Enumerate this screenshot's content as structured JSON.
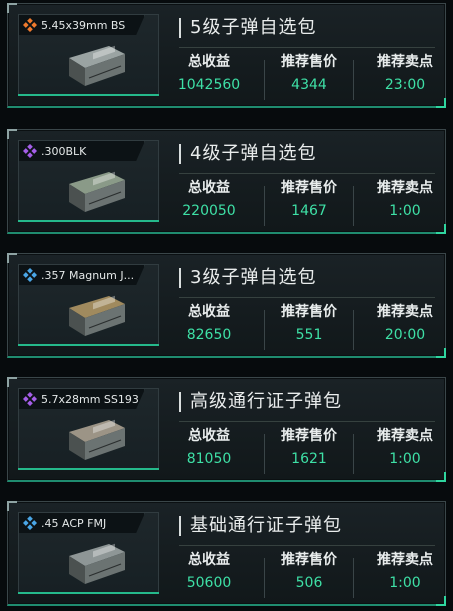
{
  "labels": {
    "total": "总收益",
    "price": "推荐售价",
    "time": "推荐卖点"
  },
  "colors": {
    "value_green": "#3ee0a6",
    "accent_green": "#25b98b"
  },
  "packs": [
    {
      "caliber": "5.45x39mm BS",
      "title": "5级子弹自选包",
      "total": "1042560",
      "price": "4344",
      "time": "23:00",
      "icon": "orange-diamond-icon",
      "icon_color": "#f07a2d",
      "ammo_color": "#9aa3a2"
    },
    {
      "caliber": ".300BLK",
      "title": "4级子弹自选包",
      "total": "220050",
      "price": "1467",
      "time": "1:00",
      "icon": "purple-diamond-icon",
      "icon_color": "#a45ee8",
      "ammo_color": "#8a9a88"
    },
    {
      "caliber": ".357 Magnum J...",
      "title": "3级子弹自选包",
      "total": "82650",
      "price": "551",
      "time": "20:00",
      "icon": "blue-diamond-icon",
      "icon_color": "#4aa6e6",
      "ammo_color": "#a08a5e"
    },
    {
      "caliber": "5.7x28mm SS193",
      "title": "高级通行证子弹包",
      "total": "81050",
      "price": "1621",
      "time": "1:00",
      "icon": "purple-diamond-icon",
      "icon_color": "#a45ee8",
      "ammo_color": "#9c9486"
    },
    {
      "caliber": ".45 ACP FMJ",
      "title": "基础通行证子弹包",
      "total": "50600",
      "price": "506",
      "time": "1:00",
      "icon": "blue-diamond-icon",
      "icon_color": "#4aa6e6",
      "ammo_color": "#8e9696"
    }
  ]
}
